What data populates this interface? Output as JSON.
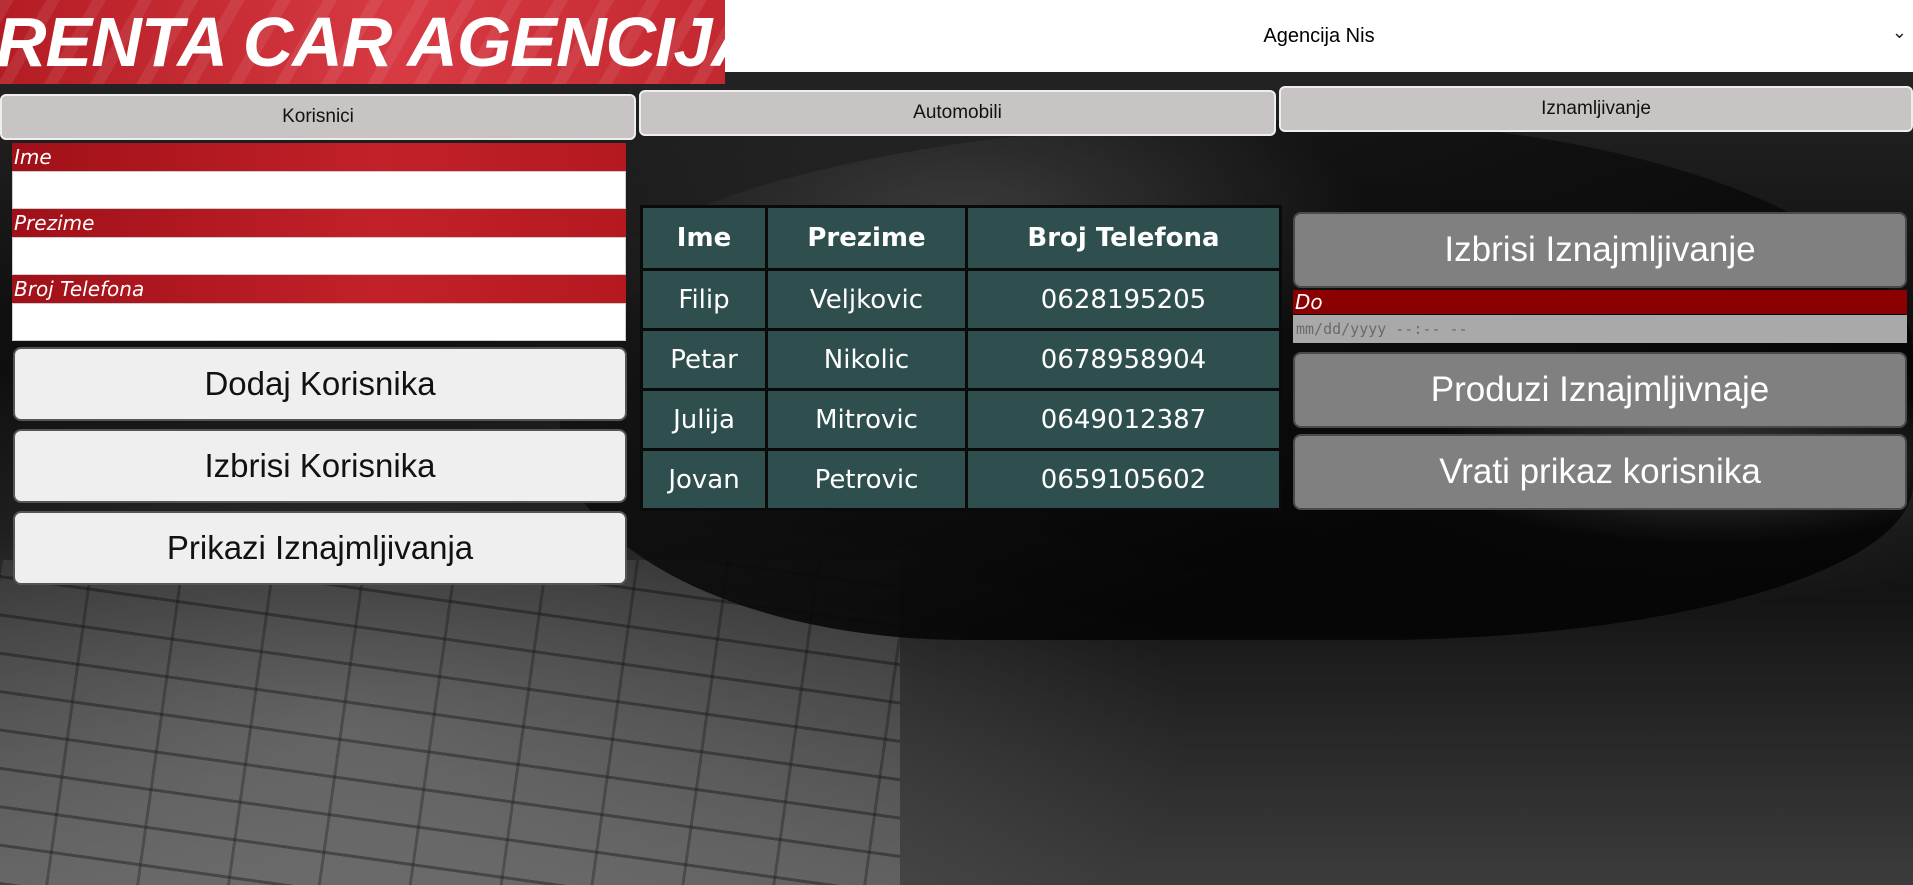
{
  "header": {
    "logo_text": "RENTA CAR AGENCIJA",
    "agency_select_value": "Agencija Nis"
  },
  "tabs": {
    "korisnici": "Korisnici",
    "automobili": "Automobili",
    "iznamljivanje": "Iznamljivanje"
  },
  "user_form": {
    "ime_label": "Ime",
    "prezime_label": "Prezime",
    "broj_telefona_label": "Broj Telefona",
    "ime_value": "",
    "prezime_value": "",
    "broj_telefona_value": "",
    "buttons": {
      "dodaj": "Dodaj Korisnika",
      "izbrisi": "Izbrisi Korisnika",
      "prikazi": "Prikazi Iznajmljivanja"
    }
  },
  "users_table": {
    "headers": [
      "Ime",
      "Prezime",
      "Broj Telefona"
    ],
    "rows": [
      [
        "Filip",
        "Veljkovic",
        "0628195205"
      ],
      [
        "Petar",
        "Nikolic",
        "0678958904"
      ],
      [
        "Julija",
        "Mitrovic",
        "0649012387"
      ],
      [
        "Jovan",
        "Petrovic",
        "0659105602"
      ]
    ]
  },
  "rental_panel": {
    "izbrisi_button": "Izbrisi Iznajmljivanje",
    "do_label": "Do",
    "do_placeholder": "mm/dd/yyyy --:-- --",
    "produzi_button": "Produzi Iznajmljivnaje",
    "vrati_button": "Vrati prikaz korisnika"
  },
  "colors": {
    "logo_red": "#c32830",
    "label_red": "#b51920",
    "do_label_red": "#8b0000",
    "table_bg": "#2f4f4f",
    "tab_bg": "#c9c4c4",
    "right_button_bg": "#808080"
  },
  "icons": {
    "select_chevron": "chevron-down-icon"
  }
}
